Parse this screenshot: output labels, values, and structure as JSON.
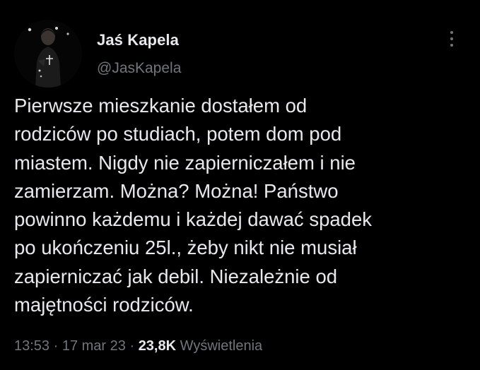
{
  "author": {
    "name": "Jaś Kapela",
    "handle": "@JasKapela",
    "avatar_icon": "profile-photo"
  },
  "more_icon": "more-vertical-icon",
  "tweet": {
    "lines": [
      "Pierwsze mieszkanie dostałem od",
      "rodziców po studiach, potem dom pod",
      "miastem. Nigdy nie zapierniczałem i nie",
      "zamierzam. Można? Można! Państwo",
      "powinno każdemu i każdej dawać spadek",
      "po ukończeniu 25l., żeby nikt nie musiał",
      "zapierniczać jak debil. Niezależnie od",
      "majętności rodziców."
    ]
  },
  "meta": {
    "time": "13:53",
    "date": "17 mar 23",
    "views_count": "23,8K",
    "views_label": "Wyświetlenia",
    "separator": "·"
  },
  "colors": {
    "background": "#000000",
    "text_primary": "#e7e9ea",
    "text_secondary": "#71767b"
  }
}
